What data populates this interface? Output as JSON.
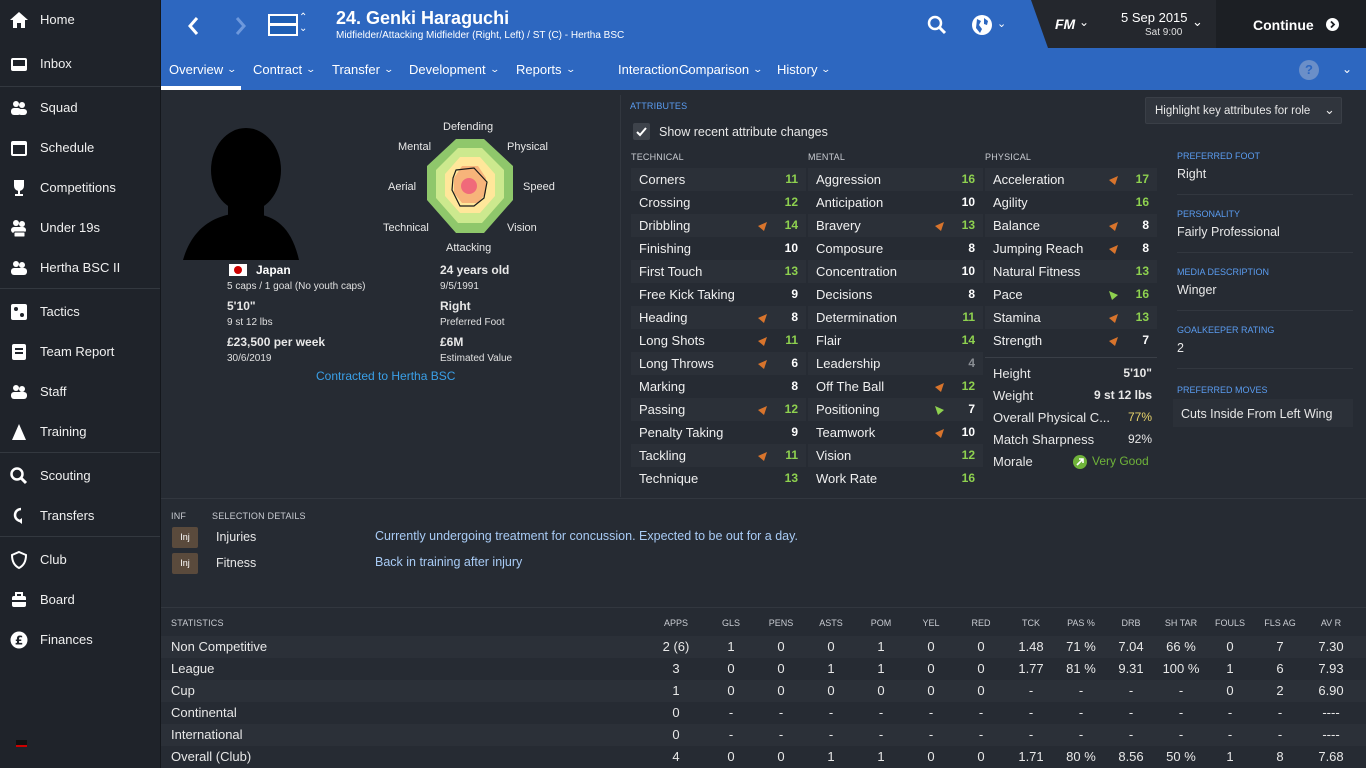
{
  "sidebar": {
    "items": [
      {
        "label": "Home",
        "icon": "home-icon"
      },
      {
        "label": "Inbox",
        "icon": "inbox-icon"
      },
      {
        "label": "Squad",
        "icon": "squad-icon"
      },
      {
        "label": "Schedule",
        "icon": "calendar-icon"
      },
      {
        "label": "Competitions",
        "icon": "trophy-icon"
      },
      {
        "label": "Under 19s",
        "icon": "u19-icon"
      },
      {
        "label": "Hertha BSC II",
        "icon": "reserve-icon"
      },
      {
        "label": "Tactics",
        "icon": "tactics-icon"
      },
      {
        "label": "Team Report",
        "icon": "report-icon"
      },
      {
        "label": "Staff",
        "icon": "staff-icon"
      },
      {
        "label": "Training",
        "icon": "training-icon"
      },
      {
        "label": "Scouting",
        "icon": "search-icon"
      },
      {
        "label": "Transfers",
        "icon": "transfers-icon"
      },
      {
        "label": "Club",
        "icon": "shield-icon"
      },
      {
        "label": "Board",
        "icon": "board-icon"
      },
      {
        "label": "Finances",
        "icon": "pound-icon"
      }
    ]
  },
  "header": {
    "title": "24. Genki Haraguchi",
    "subtitle": "Midfielder/Attacking Midfielder (Right, Left) / ST (C) - Hertha BSC",
    "date": "5 Sep 2015",
    "time": "Sat 9:00",
    "continue": "Continue",
    "fm": "FM",
    "tabs": [
      "Overview",
      "Contract",
      "Transfer",
      "Development",
      "Reports",
      "Interaction",
      "Comparison",
      "History"
    ]
  },
  "profile": {
    "nation": "Japan",
    "caps": "5 caps / 1 goal (No youth caps)",
    "height": "5'10\"",
    "weight": "9 st 12 lbs",
    "wage": "£23,500 per week",
    "wage_until": "30/6/2019",
    "age": "24 years old",
    "dob": "9/5/1991",
    "foot": "Right",
    "foot_label": "Preferred Foot",
    "value": "£6M",
    "value_label": "Estimated Value",
    "contract": "Contracted to Hertha BSC"
  },
  "radar": {
    "labels": [
      "Defending",
      "Physical",
      "Speed",
      "Vision",
      "Attacking",
      "Technical",
      "Aerial",
      "Mental"
    ]
  },
  "attributes": {
    "title": "ATTRIBUTES",
    "highlight": "Highlight key attributes for role",
    "show_changes": "Show recent attribute changes",
    "technical_label": "TECHNICAL",
    "mental_label": "MENTAL",
    "physical_label": "PHYSICAL",
    "technical": [
      [
        "Corners",
        "11",
        ""
      ],
      [
        "Crossing",
        "12",
        ""
      ],
      [
        "Dribbling",
        "14",
        "down"
      ],
      [
        "Finishing",
        "10",
        ""
      ],
      [
        "First Touch",
        "13",
        ""
      ],
      [
        "Free Kick Taking",
        "9",
        ""
      ],
      [
        "Heading",
        "8",
        "down"
      ],
      [
        "Long Shots",
        "11",
        "down"
      ],
      [
        "Long Throws",
        "6",
        "down"
      ],
      [
        "Marking",
        "8",
        ""
      ],
      [
        "Passing",
        "12",
        "down"
      ],
      [
        "Penalty Taking",
        "9",
        ""
      ],
      [
        "Tackling",
        "11",
        "down"
      ],
      [
        "Technique",
        "13",
        ""
      ]
    ],
    "mental": [
      [
        "Aggression",
        "16",
        ""
      ],
      [
        "Anticipation",
        "10",
        ""
      ],
      [
        "Bravery",
        "13",
        "down"
      ],
      [
        "Composure",
        "8",
        ""
      ],
      [
        "Concentration",
        "10",
        ""
      ],
      [
        "Decisions",
        "8",
        ""
      ],
      [
        "Determination",
        "11",
        ""
      ],
      [
        "Flair",
        "14",
        ""
      ],
      [
        "Leadership",
        "4",
        ""
      ],
      [
        "Off The Ball",
        "12",
        "down"
      ],
      [
        "Positioning",
        "7",
        "up"
      ],
      [
        "Teamwork",
        "10",
        "down"
      ],
      [
        "Vision",
        "12",
        ""
      ],
      [
        "Work Rate",
        "16",
        ""
      ]
    ],
    "physical": [
      [
        "Acceleration",
        "17",
        "down"
      ],
      [
        "Agility",
        "16",
        ""
      ],
      [
        "Balance",
        "8",
        "down"
      ],
      [
        "Jumping Reach",
        "8",
        "down"
      ],
      [
        "Natural Fitness",
        "13",
        ""
      ],
      [
        "Pace",
        "16",
        "up"
      ],
      [
        "Stamina",
        "13",
        "down"
      ],
      [
        "Strength",
        "7",
        "down"
      ]
    ],
    "extra": [
      [
        "Height",
        "5'10\""
      ],
      [
        "Weight",
        "9 st 12 lbs"
      ],
      [
        "Overall Physical C...",
        "77%"
      ],
      [
        "Match Sharpness",
        "92%"
      ],
      [
        "Morale",
        "Very Good"
      ]
    ]
  },
  "side_panel": {
    "foot_label": "PREFERRED FOOT",
    "foot": "Right",
    "personality_label": "PERSONALITY",
    "personality": "Fairly Professional",
    "media_label": "MEDIA DESCRIPTION",
    "media": "Winger",
    "gk_label": "GOALKEEPER RATING",
    "gk": "2",
    "moves_label": "PREFERRED MOVES",
    "moves": "Cuts Inside From Left Wing"
  },
  "selection": {
    "inf_label": "INF",
    "title": "SELECTION DETAILS",
    "rows": [
      [
        "Inj",
        "Injuries",
        "Currently undergoing treatment for concussion. Expected to be out for a day."
      ],
      [
        "Inj",
        "Fitness",
        "Back in training after injury"
      ]
    ]
  },
  "stats": {
    "title": "STATISTICS",
    "headers": [
      "APPS",
      "GLS",
      "PENS",
      "ASTS",
      "POM",
      "YEL",
      "RED",
      "TCK",
      "PAS %",
      "DRB",
      "SH TAR",
      "FOULS",
      "FLS AG",
      "AV R"
    ],
    "rows": [
      [
        "Non Competitive",
        "2 (6)",
        "1",
        "0",
        "0",
        "1",
        "0",
        "0",
        "1.48",
        "71 %",
        "7.04",
        "66 %",
        "0",
        "7",
        "7.30"
      ],
      [
        "League",
        "3",
        "0",
        "0",
        "1",
        "1",
        "0",
        "0",
        "1.77",
        "81 %",
        "9.31",
        "100 %",
        "1",
        "6",
        "7.93"
      ],
      [
        "Cup",
        "1",
        "0",
        "0",
        "0",
        "0",
        "0",
        "0",
        "-",
        "-",
        "-",
        "-",
        "0",
        "2",
        "6.90"
      ],
      [
        "Continental",
        "0",
        "-",
        "-",
        "-",
        "-",
        "-",
        "-",
        "-",
        "-",
        "-",
        "-",
        "-",
        "-",
        "----"
      ],
      [
        "International",
        "0",
        "-",
        "-",
        "-",
        "-",
        "-",
        "-",
        "-",
        "-",
        "-",
        "-",
        "-",
        "-",
        "----"
      ],
      [
        "Overall (Club)",
        "4",
        "0",
        "0",
        "1",
        "1",
        "0",
        "0",
        "1.71",
        "80 %",
        "8.56",
        "50 %",
        "1",
        "8",
        "7.68"
      ]
    ]
  },
  "colors": {
    "header_blue": "#2d67c0",
    "good": "#8ed14f",
    "ok": "#d7d77b",
    "arrow_down": "#d8742c",
    "arrow_up": "#8ed14f"
  }
}
